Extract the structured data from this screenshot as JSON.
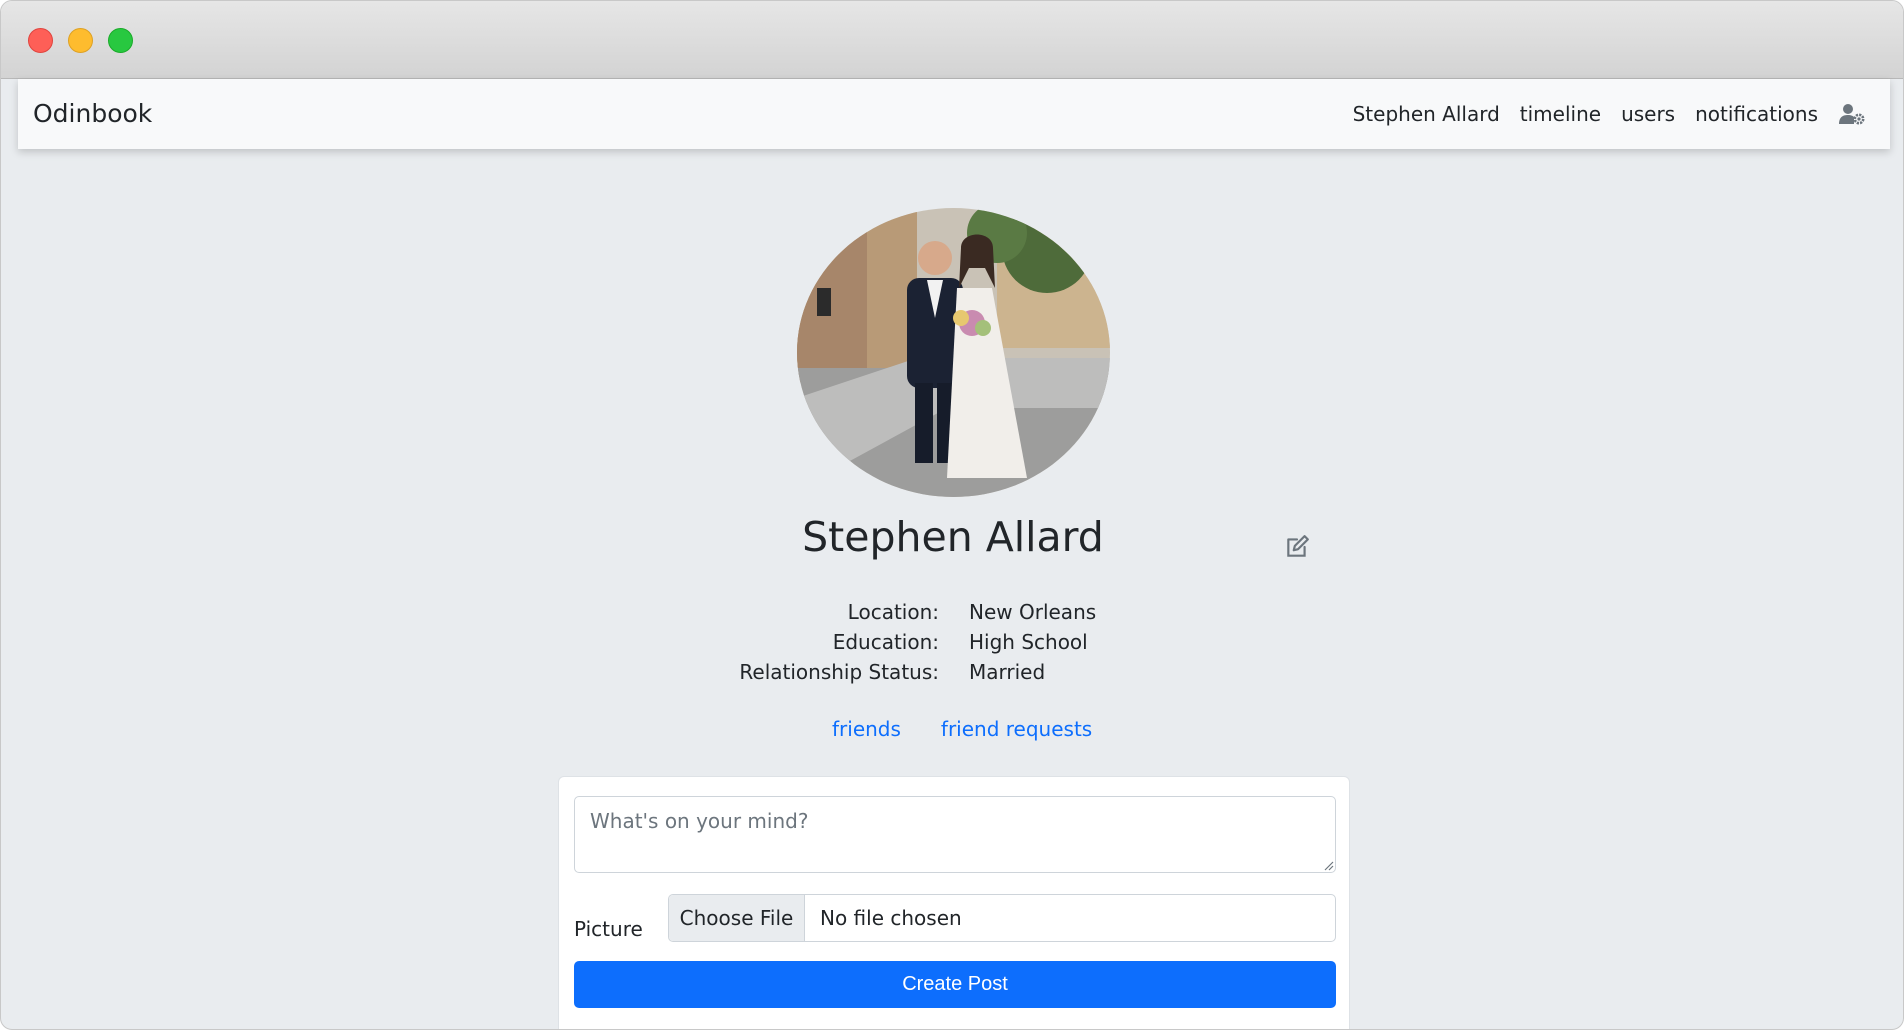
{
  "navbar": {
    "brand": "Odinbook",
    "links": [
      "Stephen Allard",
      "timeline",
      "users",
      "notifications"
    ],
    "settings_icon": "user-gear-icon"
  },
  "profile": {
    "photo_alt": "Profile photo of a couple in wedding attire standing on a street",
    "name": "Stephen Allard",
    "edit_icon": "edit-icon",
    "details": [
      {
        "label": "Location:",
        "value": "New Orleans"
      },
      {
        "label": "Education:",
        "value": "High School"
      },
      {
        "label": "Relationship Status:",
        "value": "Married"
      }
    ],
    "links": {
      "friends": "friends",
      "friend_requests": "friend requests"
    }
  },
  "post_form": {
    "placeholder": "What's on your mind?",
    "picture_label": "Picture",
    "choose_file": "Choose File",
    "file_status": "No file chosen",
    "submit": "Create Post"
  },
  "colors": {
    "primary": "#0d6efd",
    "background": "#e9ecef",
    "navbar": "#f8f9fa"
  }
}
